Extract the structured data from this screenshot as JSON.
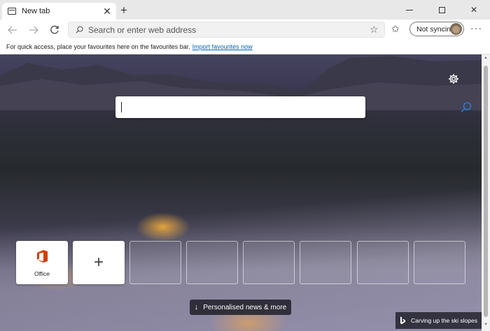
{
  "browser": {
    "tab": {
      "title": "New tab",
      "close_icon": "close-icon"
    },
    "new_tab_icon": "plus-icon",
    "window_controls": [
      "minimize-icon",
      "maximize-icon",
      "close-icon"
    ]
  },
  "toolbar": {
    "address_placeholder": "Search or enter web address",
    "profile_label": "Not syncing"
  },
  "favourites_bar": {
    "text": "For quick access, place your favourites here on the favourites bar.",
    "link": "Import favourites now"
  },
  "new_tab_page": {
    "search_placeholder": "",
    "tiles": [
      {
        "label": "Office",
        "type": "site",
        "icon": "office-icon"
      },
      {
        "label": "",
        "type": "add",
        "icon": "plus-icon"
      },
      {
        "label": "",
        "type": "empty"
      },
      {
        "label": "",
        "type": "empty"
      },
      {
        "label": "",
        "type": "empty"
      },
      {
        "label": "",
        "type": "empty"
      },
      {
        "label": "",
        "type": "empty"
      },
      {
        "label": "",
        "type": "empty"
      }
    ],
    "news_button": "Personalised news & more",
    "image_caption": "Carving up the ski slopes"
  },
  "colors": {
    "link": "#0067b8",
    "office_red": "#d83b01",
    "tab_bar": "#e8e8e8"
  }
}
